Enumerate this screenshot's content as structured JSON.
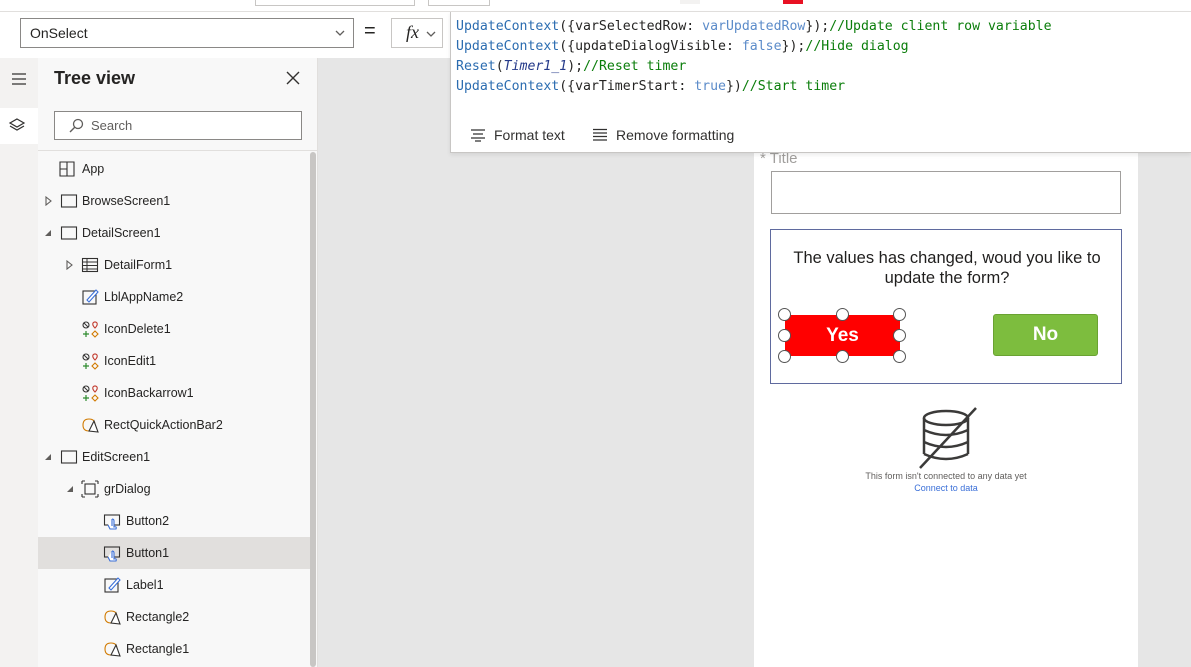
{
  "property_bar": {
    "selected_property": "OnSelect",
    "equals": "=",
    "fx_label": "fx"
  },
  "formula": {
    "lines": [
      {
        "fn": "UpdateContext",
        "open": "({",
        "text": "varSelectedRow: ",
        "value": "varUpdatedRow",
        "close": "});",
        "comment": "//Update client row variable"
      },
      {
        "fn": "UpdateContext",
        "open": "({",
        "text": "updateDialogVisible: ",
        "value": "false",
        "close": "});",
        "comment": "//Hide dialog"
      },
      {
        "fn": "Reset",
        "open": "(",
        "text": "",
        "value": "Timer1_1",
        "close": ");",
        "comment": "//Reset timer"
      },
      {
        "fn": "UpdateContext",
        "open": "({",
        "text": "varTimerStart: ",
        "value": "true",
        "close": "})",
        "comment": "//Start timer"
      }
    ],
    "format_text": "Format text",
    "remove_formatting": "Remove formatting"
  },
  "tree": {
    "title": "Tree view",
    "search_placeholder": "Search",
    "nodes": [
      {
        "label": "App",
        "level": 0,
        "expand": "none",
        "icon": "app-icon"
      },
      {
        "label": "BrowseScreen1",
        "level": 0,
        "expand": "collapsed",
        "icon": "screen-icon"
      },
      {
        "label": "DetailScreen1",
        "level": 0,
        "expand": "expanded",
        "icon": "screen-icon"
      },
      {
        "label": "DetailForm1",
        "level": 1,
        "expand": "collapsed",
        "icon": "form-icon"
      },
      {
        "label": "LblAppName2",
        "level": 1,
        "expand": "none",
        "icon": "label-icon"
      },
      {
        "label": "IconDelete1",
        "level": 1,
        "expand": "none",
        "icon": "icons-icon"
      },
      {
        "label": "IconEdit1",
        "level": 1,
        "expand": "none",
        "icon": "icons-icon"
      },
      {
        "label": "IconBackarrow1",
        "level": 1,
        "expand": "none",
        "icon": "icons-icon"
      },
      {
        "label": "RectQuickActionBar2",
        "level": 1,
        "expand": "none",
        "icon": "shape-icon"
      },
      {
        "label": "EditScreen1",
        "level": 0,
        "expand": "expanded",
        "icon": "screen-icon"
      },
      {
        "label": "grDialog",
        "level": 1,
        "expand": "expanded",
        "icon": "group-icon"
      },
      {
        "label": "Button2",
        "level": 2,
        "expand": "none",
        "icon": "button-icon"
      },
      {
        "label": "Button1",
        "level": 2,
        "expand": "none",
        "icon": "button-icon",
        "selected": true
      },
      {
        "label": "Label1",
        "level": 2,
        "expand": "none",
        "icon": "label-icon"
      },
      {
        "label": "Rectangle2",
        "level": 2,
        "expand": "none",
        "icon": "shape-icon"
      },
      {
        "label": "Rectangle1",
        "level": 2,
        "expand": "none",
        "icon": "shape-icon"
      }
    ]
  },
  "canvas": {
    "field_label": "* Title",
    "dialog_text": "The values has changed, woud you like to update the form?",
    "yes_label": "Yes",
    "no_label": "No",
    "no_data_text": "This form isn't connected to any data yet",
    "connect_link": "Connect to data"
  },
  "colors": {
    "yes_button": "#ff0000",
    "no_button": "#7dbd3e",
    "dialog_border": "#5f6a9e",
    "function": "#2b6cb0",
    "comment": "#0a7d0a",
    "selected_row": "#e1dfdd"
  }
}
